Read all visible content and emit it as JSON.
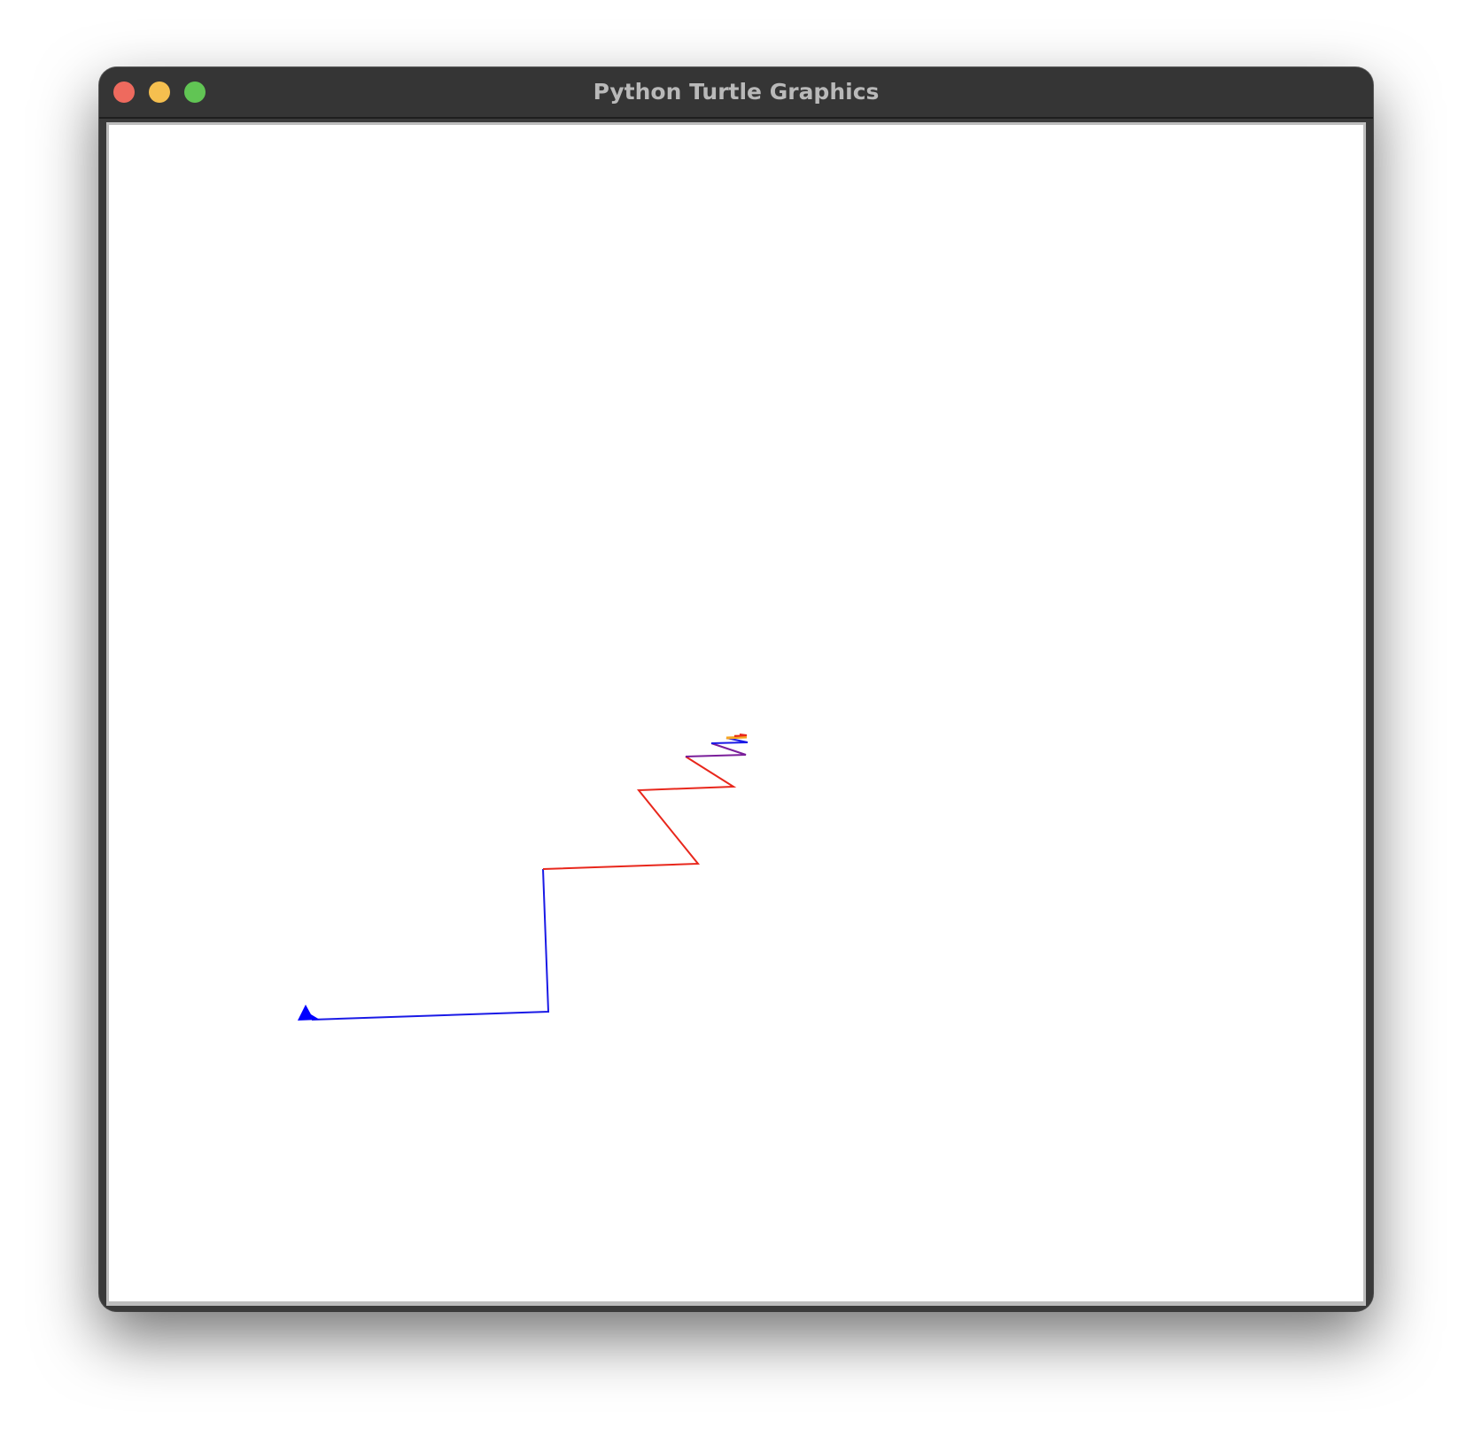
{
  "window": {
    "title": "Python Turtle Graphics"
  },
  "titlebar_buttons": [
    "close",
    "minimize",
    "zoom"
  ],
  "colors": {
    "blue": "#1a1ae6",
    "red": "#e8271c",
    "purple": "#7a1e9a",
    "orange": "#f5a623",
    "turtle": "#0000ff"
  },
  "turtle": {
    "shape": "classic-arrow-icon",
    "color": "#0000ff"
  }
}
